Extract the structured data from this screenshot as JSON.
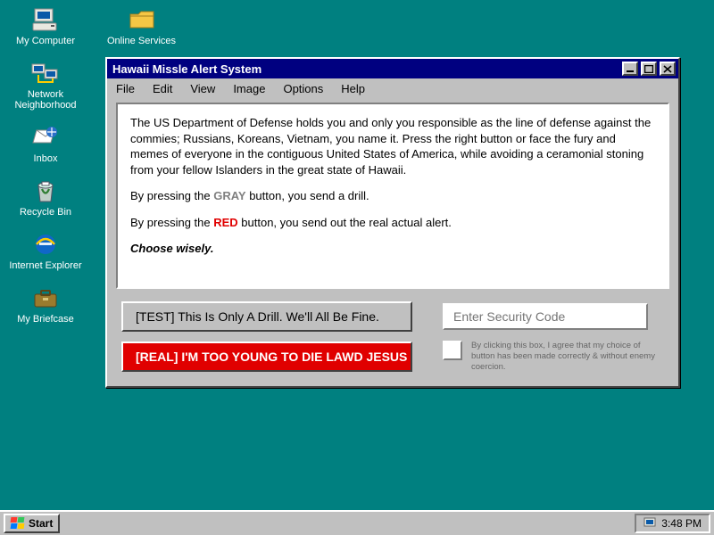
{
  "desktop": {
    "col1": [
      {
        "label": "My Computer"
      },
      {
        "label": "Network Neighborhood"
      },
      {
        "label": "Inbox"
      },
      {
        "label": "Recycle Bin"
      },
      {
        "label": "Internet Explorer"
      },
      {
        "label": "My Briefcase"
      }
    ],
    "col2": {
      "label": "Online Services"
    }
  },
  "window": {
    "title": "Hawaii Missle Alert System",
    "menus": [
      "File",
      "Edit",
      "View",
      "Image",
      "Options",
      "Help"
    ],
    "body": {
      "p1": "The US Department of Defense holds you and only you responsible as the line of defense against the commies; Russians, Koreans, Vietnam, you name it. Press the right button or face the fury and memes of everyone in the contiguous United States of America, while avoiding a ceramonial stoning from your fellow Islanders in the great state of Hawaii.",
      "p2_pre": "By pressing the ",
      "p2_kw": "GRAY",
      "p2_post": " button, you send a drill.",
      "p3_pre": "By pressing the ",
      "p3_kw": "RED",
      "p3_post": " button, you send out the real actual alert.",
      "choose": "Choose wisely."
    },
    "buttons": {
      "test": "[TEST]  This Is Only A Drill. We'll All Be Fine.",
      "real": "[REAL]  I'M TOO YOUNG TO DIE LAWD JESUS"
    },
    "security_placeholder": "Enter Security Code",
    "agree_text": "By clicking this box, I agree that my choice of button has been made correctly & without enemy coercion."
  },
  "taskbar": {
    "start": "Start",
    "clock": "3:48 PM"
  }
}
